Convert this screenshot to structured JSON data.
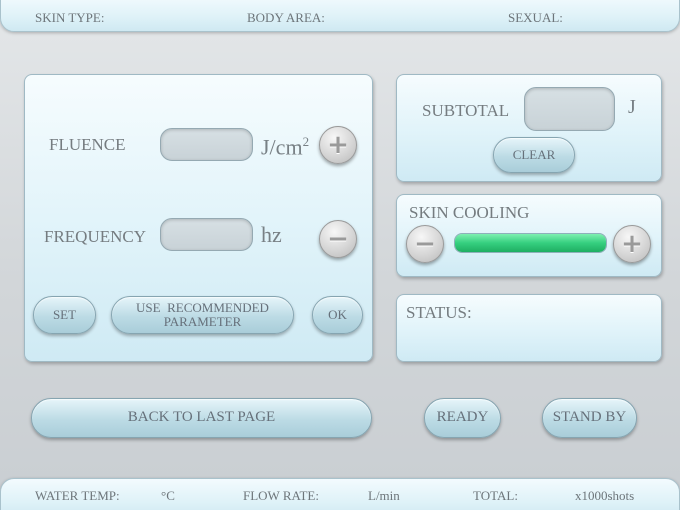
{
  "header": {
    "skin_type_label": "SKIN TYPE:",
    "body_area_label": "BODY AREA:",
    "sexual_label": "SEXUAL:"
  },
  "params": {
    "fluence_label": "FLUENCE",
    "fluence_unit": "J/cm",
    "fluence_unit_exp": "2",
    "fluence_value": "",
    "frequency_label": "FREQUENCY",
    "frequency_unit": "hz",
    "frequency_value": "",
    "plus_glyph": "+",
    "minus_glyph": "−",
    "set_label": "SET",
    "recommended_line1": "USE  RECOMMENDED",
    "recommended_line2": "PARAMETER",
    "ok_label": "OK"
  },
  "subtotal": {
    "label": "SUBTOTAL",
    "unit": "J",
    "value": "",
    "clear_label": "CLEAR"
  },
  "cooling": {
    "label": "SKIN COOLING",
    "level": 1.0,
    "minus_glyph": "−",
    "plus_glyph": "+"
  },
  "status": {
    "label": "STATUS:"
  },
  "actions": {
    "back_label": "BACK TO LAST PAGE",
    "ready_label": "READY",
    "standby_label": "STAND BY"
  },
  "footer": {
    "water_temp_label": "WATER TEMP:",
    "water_temp_unit": "°C",
    "flow_rate_label": "FLOW RATE:",
    "flow_rate_unit": "L/min",
    "total_label": "TOTAL:",
    "total_unit": "x1000shots"
  },
  "colors": {
    "cooling_fill": "#35cf7f",
    "panel_bg": "#e2f4fa",
    "text": "#757c80"
  },
  "icons": {
    "increase": "plus-icon",
    "decrease": "minus-icon"
  }
}
